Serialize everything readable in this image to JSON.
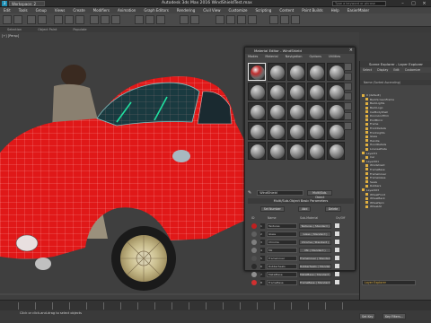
{
  "titlebar": {
    "logo": "3",
    "workspace": "Workspace: 2",
    "title": "Autodesk 3ds Max 2016    WindShieldTest.max",
    "search": "Type a keyword or phrase"
  },
  "menubar": [
    "Edit",
    "Tools",
    "Group",
    "Views",
    "Create",
    "Modifiers",
    "Animation",
    "Graph Editors",
    "Rendering",
    "Civil View",
    "Customize",
    "Scripting",
    "Content",
    "Point Builds",
    "Help",
    "EasierMaker"
  ],
  "ribbon": [
    "Selection",
    "Object Paint",
    "Populate"
  ],
  "viewport": {
    "label": "[+] [Persp]"
  },
  "mat_editor": {
    "title": "Material Editor - WindShield",
    "menu": [
      "Modes",
      "Material",
      "Navigation",
      "Options",
      "Utilities"
    ],
    "name": "WindShield",
    "type": "Multi/Sub-Object",
    "rollout": "Multi/Sub-Object Basic Parameters",
    "buttons": [
      "Set Number",
      "Add",
      "Delete"
    ],
    "columns": [
      "ID",
      "Name",
      "Sub-Material",
      "On/Off"
    ],
    "rows": [
      {
        "id": "1",
        "name": "Textures",
        "mat": "Textures  ( Standard )",
        "color": "#c02020"
      },
      {
        "id": "2",
        "name": "Glass",
        "mat": "Glass  ( Standard )",
        "color": "#606060"
      },
      {
        "id": "3",
        "name": "Chrome",
        "mat": "Chrome  ( Standard )",
        "color": "#808080"
      },
      {
        "id": "4",
        "name": "Mk",
        "mat": "Mk  ( Standard )",
        "color": "#7a7a7a"
      },
      {
        "id": "5",
        "name": "FrameCover",
        "mat": "FrameCover  ( Standard )",
        "color": "#505050"
      },
      {
        "id": "6",
        "name": "RubberSeals",
        "mat": "RubberSeals  ( Standard )",
        "color": "#2a2a2a"
      },
      {
        "id": "7",
        "name": "MetalBase",
        "mat": "MetalBase  ( Standard )",
        "color": "#909090"
      },
      {
        "id": "8",
        "name": "FrameBase",
        "mat": "FrameBase  ( Standard )",
        "color": "#d03030"
      }
    ]
  },
  "scene_explorer": {
    "title": "Scene Explorer - Layer Explorer",
    "menu": [
      "Select",
      "Display",
      "Edit",
      "Customize"
    ],
    "header": "Name (Sorted Ascending)",
    "items": [
      "0 (default)",
      "BackScreenFrame",
      "BackLights",
      "BackLogo",
      "CarBodyShell",
      "DoorsAndTrim",
      "EndMirror",
      "Frame",
      "FrontDetails",
      "FrontLights",
      "Glass",
      "Handle",
      "HoodDetails",
      "LicensePlate",
      "Layer01",
      "Car",
      "Layer001",
      "Windshield",
      "FrameBase",
      "FrameCover",
      "FrameGlass",
      "Seals",
      "Rubbers",
      "Layer003",
      "WheelFront",
      "WheelBack",
      "WheelSpin",
      "WheelAll"
    ],
    "footer": "Layer Explorer"
  },
  "status": {
    "text": "Click or click-and-drag to select objects",
    "buttons": [
      "Set Key",
      "Key Filters..."
    ]
  },
  "colors": {
    "body_red": "#e01818",
    "accent": "#1f8fb5"
  }
}
